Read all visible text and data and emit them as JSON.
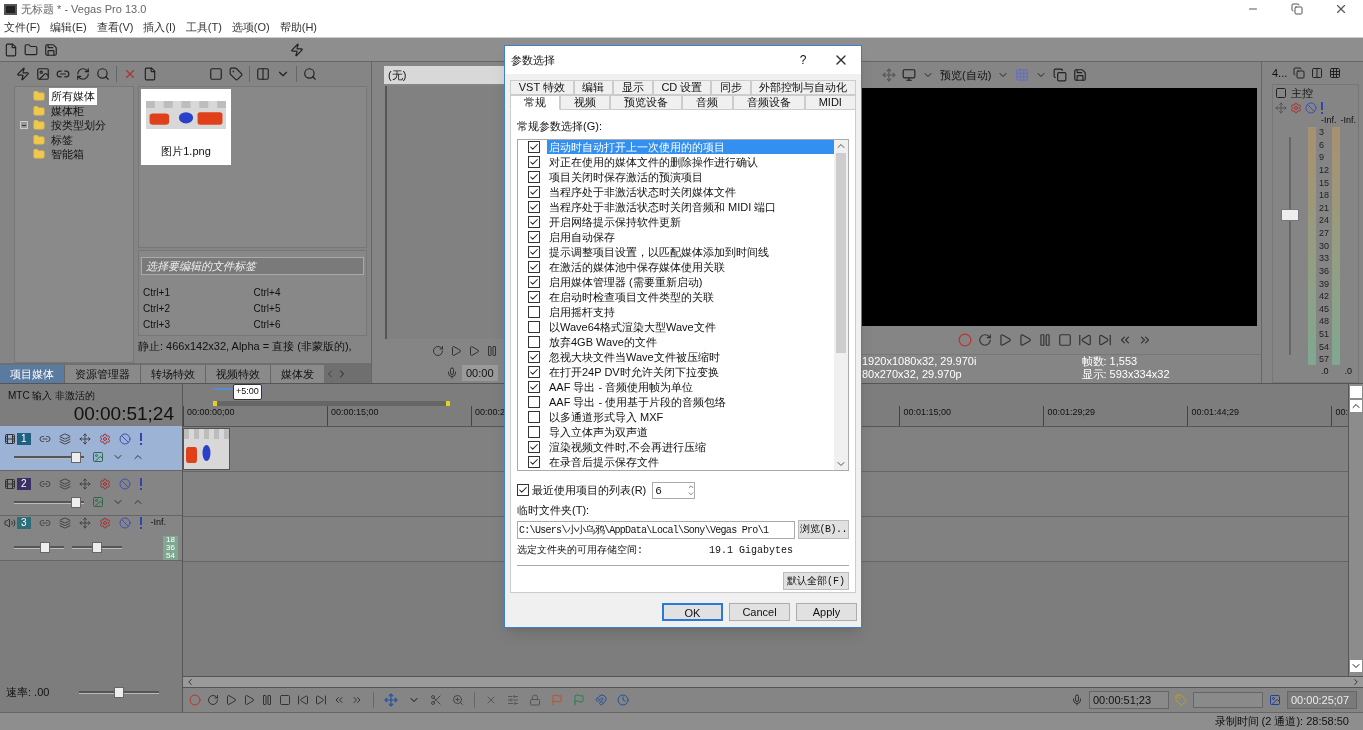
{
  "window": {
    "title": "无标题 * - Vegas Pro 13.0"
  },
  "menu": [
    "文件(F)",
    "编辑(E)",
    "查看(V)",
    "插入(I)",
    "工具(T)",
    "选项(O)",
    "帮助(H)"
  ],
  "explorer": {
    "tree": [
      {
        "label": "所有媒体",
        "selected": true,
        "expander": false
      },
      {
        "label": "媒体柜",
        "selected": false,
        "expander": false
      },
      {
        "label": "按类型划分",
        "selected": false,
        "expander": true
      },
      {
        "label": "标签",
        "selected": false,
        "expander": false
      },
      {
        "label": "智能箱",
        "selected": false,
        "expander": false
      }
    ],
    "media": [
      {
        "name": "图片1.png",
        "kind": "picture"
      }
    ],
    "tag_field": {
      "placeholder": "选择要编辑的文件标签"
    },
    "shortcuts": [
      "Ctrl+1",
      "Ctrl+4",
      "Ctrl+2",
      "Ctrl+5",
      "Ctrl+3",
      "Ctrl+6"
    ],
    "info": "静止: 466x142x32,  Alpha = 直接 (非蒙版的),"
  },
  "dock_tabs": [
    {
      "label": "项目媒体",
      "selected": true
    },
    {
      "label": "资源管理器",
      "selected": false
    },
    {
      "label": "转场特效",
      "selected": false
    },
    {
      "label": "视频特效",
      "selected": false
    },
    {
      "label": "媒体发",
      "selected": false
    }
  ],
  "trimmer": {
    "title": "(无)",
    "time": "00:00"
  },
  "preview": {
    "mode": "预览(自动)",
    "project": "1920x1080x32, 29.970i",
    "preview_size": "80x270x32, 29.970p",
    "frames": "帧数: 1,553",
    "display": "显示: 593x334x32"
  },
  "master": {
    "tab": "4...",
    "title": "主控",
    "peak_left": "-Inf.",
    "peak_right": "-Inf.",
    "scale": [
      "3",
      "6",
      "9",
      "12",
      "15",
      "18",
      "21",
      "24",
      "27",
      "30",
      "33",
      "36",
      "39",
      "42",
      "45",
      "48",
      "51",
      "54",
      "57"
    ],
    "bottom_left": ".0",
    "bottom_right": ".0",
    "level": 0.65
  },
  "timeline": {
    "mtc": "MTC 输入 非激活的",
    "time": "00:00:51;24",
    "loop_label": "+5:00",
    "ruler_left": [
      "00:00:00;00",
      "00:00:15;00",
      "00:00:2"
    ],
    "ruler_right": [
      "00:01:15;00",
      "00:01:29;29",
      "00:01:44;29",
      "00:"
    ],
    "tracks": [
      {
        "kind": "video",
        "number": "1",
        "color": "#1f5f80",
        "selected": true,
        "level": 0.95
      },
      {
        "kind": "video",
        "number": "2",
        "color": "#3b3066",
        "selected": false,
        "level": 0.95
      },
      {
        "kind": "audio",
        "number": "3",
        "color": "#2c6f78",
        "selected": false,
        "level": 0.65,
        "pan": {
          "level": 0.5
        },
        "peak": "-Inf.",
        "meter": [
          "18",
          "36",
          "54"
        ]
      }
    ],
    "rate": "速率: .00",
    "rate_slider": {
      "level": 0.5
    }
  },
  "time_fields": [
    "00:00:51;23",
    "00:00:25;07"
  ],
  "status": "录制时间 (2 通道): 28:58:50",
  "dialog": {
    "title": "参数选择",
    "help": "?",
    "tabs_back": [
      {
        "label": "VST 特效",
        "selected": false
      },
      {
        "label": "编辑",
        "selected": false
      },
      {
        "label": "显示",
        "selected": false
      },
      {
        "label": "CD 设置",
        "selected": false
      },
      {
        "label": "同步",
        "selected": false
      },
      {
        "label": "外部控制与自动化",
        "selected": false
      }
    ],
    "tabs_front": [
      {
        "label": "常规",
        "selected": true
      },
      {
        "label": "视频",
        "selected": false
      },
      {
        "label": "预览设备",
        "selected": false
      },
      {
        "label": "音频",
        "selected": false
      },
      {
        "label": "音频设备",
        "selected": false
      },
      {
        "label": "MIDI",
        "selected": false
      }
    ],
    "group_label": "常规参数选择(G):",
    "options": [
      {
        "label": "启动时自动打开上一次使用的的项目",
        "checked": true,
        "selected": true
      },
      {
        "label": "对正在使用的媒体文件的删除操作进行确认",
        "checked": true,
        "selected": false
      },
      {
        "label": "项目关闭时保存激活的预演项目",
        "checked": true,
        "selected": false
      },
      {
        "label": "当程序处于非激活状态时关闭媒体文件",
        "checked": true,
        "selected": false
      },
      {
        "label": "当程序处于非激活状态时关闭音频和 MIDI 端口",
        "checked": true,
        "selected": false
      },
      {
        "label": "开启网络提示保持软件更新",
        "checked": true,
        "selected": false
      },
      {
        "label": "启用自动保存",
        "checked": true,
        "selected": false
      },
      {
        "label": "提示调整项目设置，以匹配媒体添加到时间线",
        "checked": true,
        "selected": false
      },
      {
        "label": "在激活的媒体池中保存媒体使用关联",
        "checked": true,
        "selected": false
      },
      {
        "label": "启用媒体管理器 (需要重新启动)",
        "checked": true,
        "selected": false
      },
      {
        "label": "在启动时检查项目文件类型的关联",
        "checked": true,
        "selected": false
      },
      {
        "label": "启用摇杆支持",
        "checked": false,
        "selected": false
      },
      {
        "label": "以Wave64格式渲染大型Wave文件",
        "checked": false,
        "selected": false
      },
      {
        "label": "放弃4GB Wave的文件",
        "checked": false,
        "selected": false
      },
      {
        "label": "忽视大块文件当Wave文件被压缩时",
        "checked": true,
        "selected": false
      },
      {
        "label": "在打开24P DV时允许关闭下拉变换",
        "checked": true,
        "selected": false
      },
      {
        "label": "AAF 导出 - 音频使用帧为单位",
        "checked": true,
        "selected": false
      },
      {
        "label": "AAF 导出 - 使用基于片段的音频包络",
        "checked": false,
        "selected": false
      },
      {
        "label": "以多通道形式导入 MXF",
        "checked": false,
        "selected": false
      },
      {
        "label": "导入立体声为双声道",
        "checked": false,
        "selected": false
      },
      {
        "label": "渲染视频文件时,不会再进行压缩",
        "checked": true,
        "selected": false
      },
      {
        "label": "在录音后提示保存文件",
        "checked": true,
        "selected": false
      }
    ],
    "recent": {
      "label": "最近使用项目的列表(R)",
      "checked": true,
      "value": "6"
    },
    "temp_label": "临时文件夹(T):",
    "temp_path": "C:\\Users\\小小乌鸦\\AppData\\Local\\Sony\\Vegas Pro\\1",
    "browse": "浏览(B)..",
    "space_label": "选定文件夹的可用存储空间:",
    "space_value": "19.1 Gigabytes",
    "defaults": "默认全部(F)",
    "buttons": [
      {
        "label": "OK",
        "selected": true
      },
      {
        "label": "Cancel",
        "selected": false
      },
      {
        "label": "Apply",
        "selected": false
      }
    ]
  }
}
